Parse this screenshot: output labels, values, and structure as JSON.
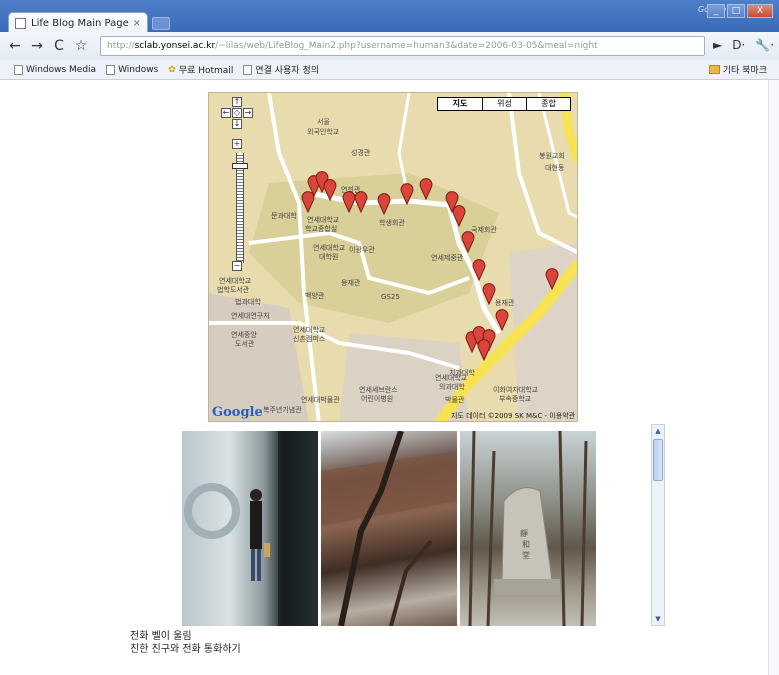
{
  "browser": {
    "tab_title": "Life Blog Main Page",
    "tab_close": "×",
    "brand": "Google",
    "window_buttons": [
      "_",
      "□",
      "X"
    ],
    "url_prefix": "http://",
    "url_host": "sclab.yonsei.ac.kr",
    "url_path": "/~lilas/web/LifeBlog_Main2.php?username=human3&date=2006-03-05&meal=night",
    "nav": {
      "back": "←",
      "forward": "→",
      "reload": "C",
      "star": "☆"
    },
    "toolbar_right": {
      "go": "►",
      "page": "D·",
      "tools": "🔧·"
    }
  },
  "bookmarks": {
    "items": [
      "Windows Media",
      "Windows",
      "무료 Hotmail",
      "연결 사용자 정의"
    ],
    "other": "기타 북마크"
  },
  "map": {
    "type_buttons": [
      "지도",
      "위성",
      "종합"
    ],
    "zoom_buttons": {
      "up": "↑",
      "left": "←",
      "center": "◇",
      "right": "→",
      "down": "↓",
      "plus": "+",
      "minus": "−"
    },
    "labels": [
      "서울",
      "외국인학교",
      "성경관",
      "연희관",
      "문과대학",
      "연세대학교",
      "학교종합실",
      "이광우관",
      "연세제중관",
      "학생회관",
      "국제회관",
      "연세대학교",
      "대학원",
      "백양관",
      "용재관",
      "GS25",
      "연세대학교",
      "법학도서관",
      "법과대학",
      "연세대연구처",
      "연세대학교",
      "신촌캠퍼스",
      "연세중앙",
      "도서관",
      "연세대학교",
      "의과대학",
      "연세대박물관",
      "연세세브란스",
      "어린이병원",
      "박물관",
      "이화여자대학교",
      "부속중학교",
      "복주년기념관",
      "용재관",
      "봉원교회",
      "대현동",
      "치과대학"
    ],
    "copyright": "지도 데이터 ©2009 SK M&C - 이용약관",
    "logo": "Google",
    "colors": {
      "land": "#e8dcae",
      "campus": "#d9cf98",
      "road": "#ffffff",
      "highway": "#f7e254",
      "marker": "#d9453a"
    }
  },
  "photos": [
    "photo-lobby",
    "photo-tree-wall",
    "photo-stone-monument"
  ],
  "caption": {
    "line1": "전화 벨이 울림",
    "line2": "친한 친구와 전화 통화하기"
  },
  "scrollbar": {
    "up": "▲",
    "down": "▼"
  }
}
